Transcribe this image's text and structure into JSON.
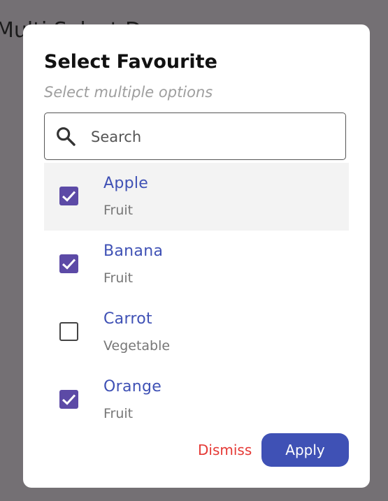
{
  "background": {
    "title": "Multi Select D"
  },
  "dialog": {
    "title": "Select Favourite",
    "subtitle": "Select multiple options",
    "search": {
      "placeholder": "Search",
      "value": "",
      "icon": "search-icon"
    },
    "items": [
      {
        "label": "Apple",
        "category": "Fruit",
        "checked": true,
        "highlighted": true
      },
      {
        "label": "Banana",
        "category": "Fruit",
        "checked": true,
        "highlighted": false
      },
      {
        "label": "Carrot",
        "category": "Vegetable",
        "checked": false,
        "highlighted": false
      },
      {
        "label": "Orange",
        "category": "Fruit",
        "checked": true,
        "highlighted": false
      }
    ],
    "actions": {
      "dismiss_label": "Dismiss",
      "apply_label": "Apply"
    }
  },
  "colors": {
    "overlay": "#747074",
    "accent": "#3f51b5",
    "checkbox": "#5c4aa6",
    "dismiss": "#e53935",
    "highlight_row": "#f3f3f3"
  }
}
